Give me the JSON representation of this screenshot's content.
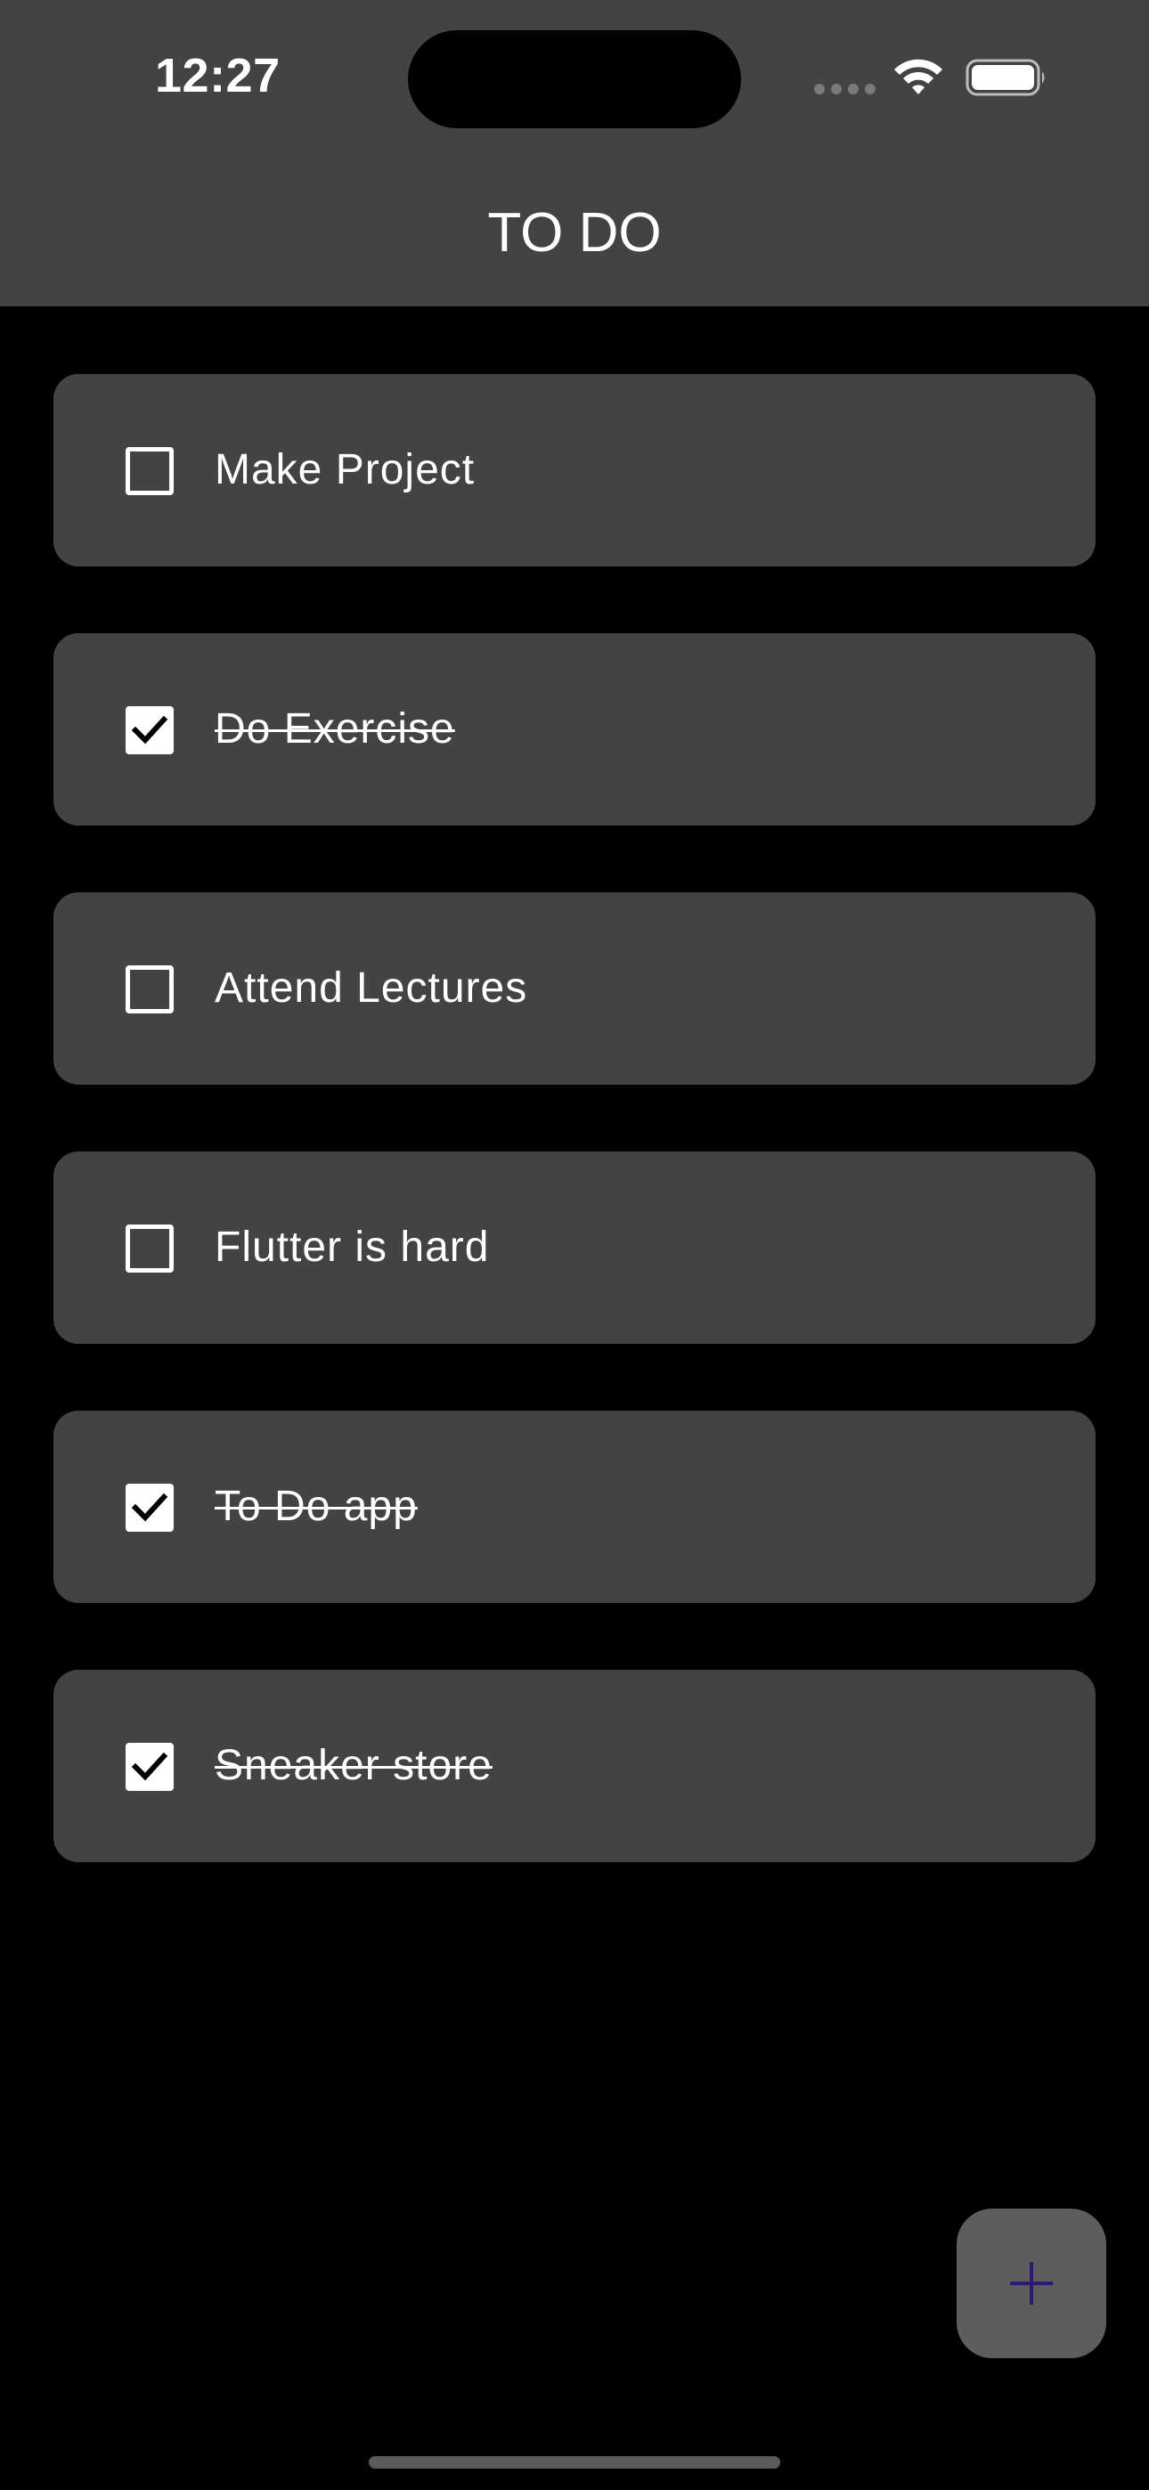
{
  "status_bar": {
    "time": "12:27",
    "icons": [
      "signal-icon",
      "wifi-icon",
      "battery-icon"
    ]
  },
  "app_bar": {
    "title": "TO DO"
  },
  "todos": [
    {
      "label": "Make Project",
      "done": false
    },
    {
      "label": "Do Exercise",
      "done": true
    },
    {
      "label": "Attend Lectures",
      "done": false
    },
    {
      "label": "Flutter is hard",
      "done": false
    },
    {
      "label": "To Do app",
      "done": true
    },
    {
      "label": "Sneaker store",
      "done": true
    }
  ],
  "fab": {
    "icon": "plus-icon",
    "icon_color": "#2b1a6e"
  },
  "colors": {
    "background": "#000000",
    "surface": "#434343",
    "fab": "#5d5d5d",
    "text": "#ffffff"
  }
}
